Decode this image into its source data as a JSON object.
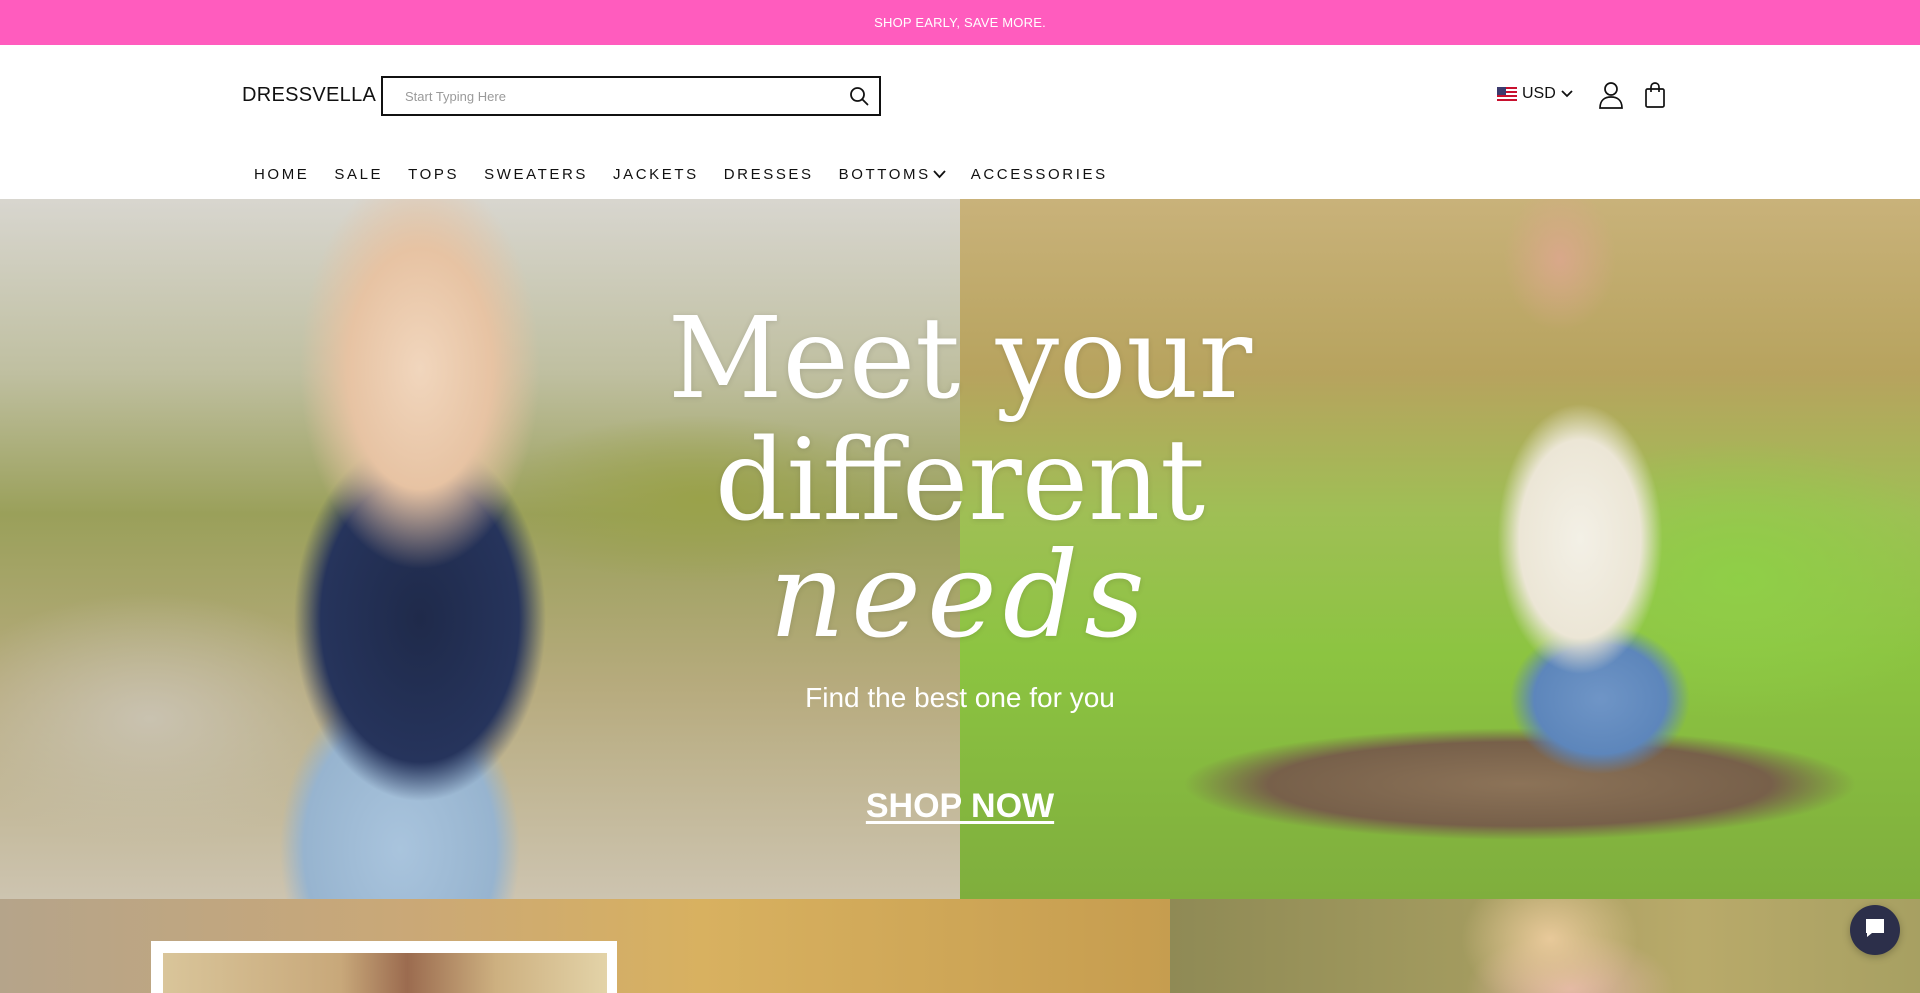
{
  "announcement": {
    "text": "SHOP EARLY, SAVE MORE.⁣⁣"
  },
  "header": {
    "logo": "DRESSVELLA",
    "search": {
      "placeholder": "Start Typing Here",
      "value": ""
    },
    "currency": {
      "code": "USD",
      "flag_icon": "us-flag-icon"
    },
    "icons": [
      "search-icon",
      "account-icon",
      "cart-icon",
      "chevron-down-icon"
    ]
  },
  "nav": {
    "items": [
      {
        "label": "HOME"
      },
      {
        "label": "SALE"
      },
      {
        "label": "TOPS"
      },
      {
        "label": "SWEATERS"
      },
      {
        "label": "JACKETS"
      },
      {
        "label": "DRESSES"
      },
      {
        "label": "BOTTOMS",
        "has_dropdown": true
      },
      {
        "label": "ACCESSORIES"
      }
    ]
  },
  "hero": {
    "headline_line1": "Meet your",
    "headline_line2": "different",
    "headline_line3": "needs",
    "subtitle": "Find the best one for you",
    "cta": "SHOP NOW"
  },
  "chat_widget": {
    "icon": "chat-bubble-icon"
  },
  "colors": {
    "announcement_bg": "#ff5cbe",
    "text": "#111111",
    "chat_bg": "#2c2f4a"
  }
}
